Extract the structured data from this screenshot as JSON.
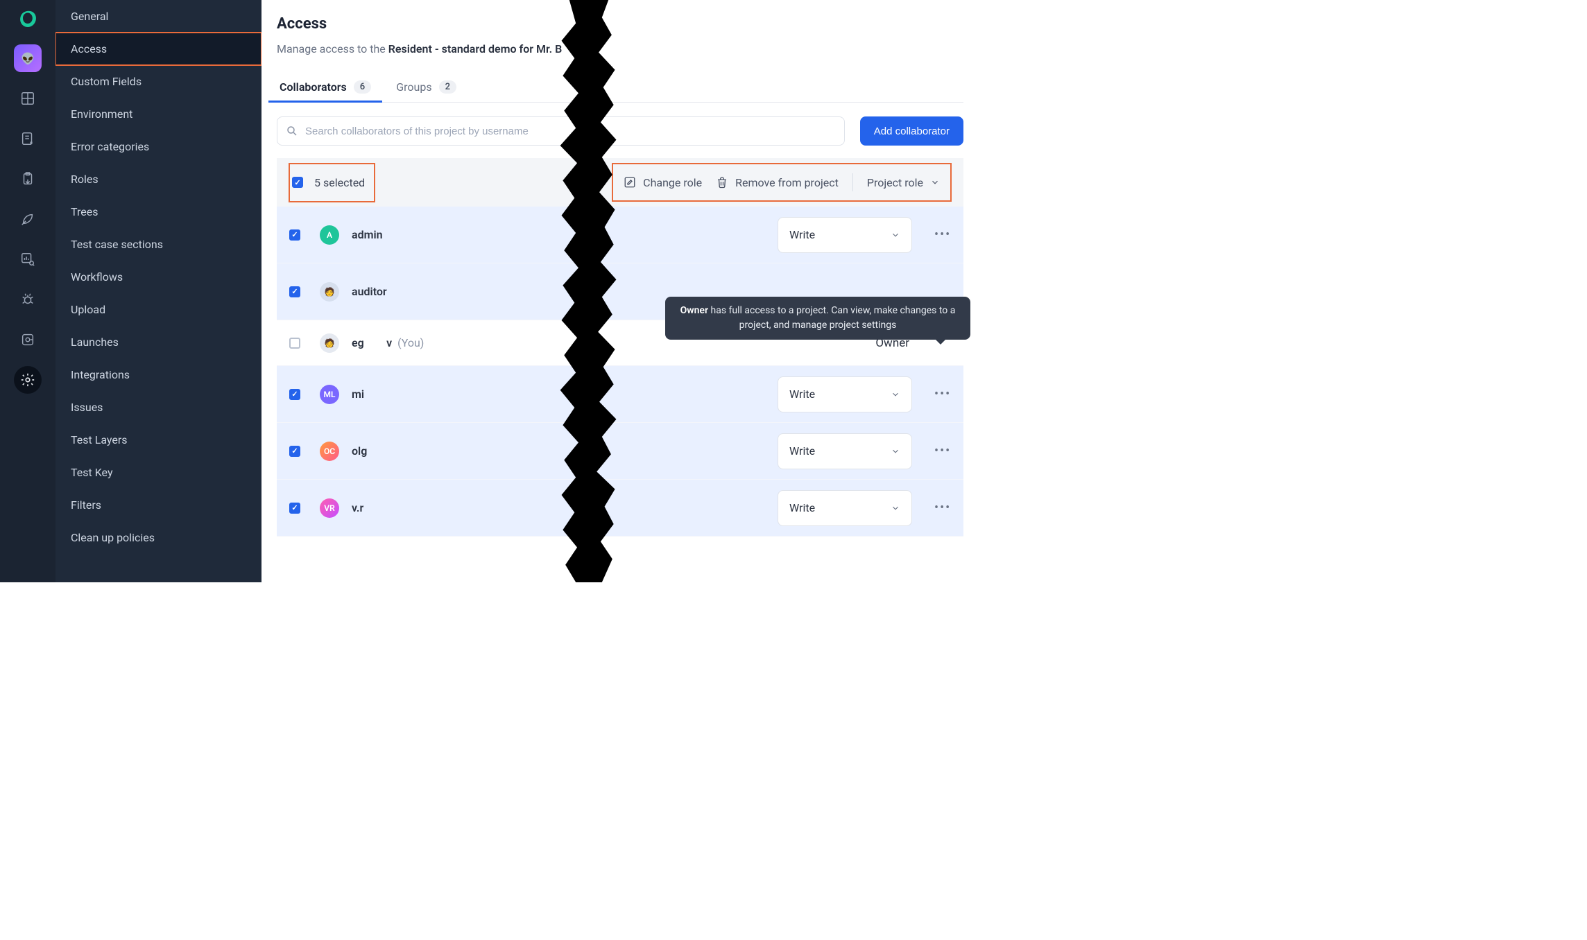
{
  "rail": {},
  "sidebar": {
    "items": [
      {
        "label": "General"
      },
      {
        "label": "Access"
      },
      {
        "label": "Custom Fields"
      },
      {
        "label": "Environment"
      },
      {
        "label": "Error categories"
      },
      {
        "label": "Roles"
      },
      {
        "label": "Trees"
      },
      {
        "label": "Test case sections"
      },
      {
        "label": "Workflows"
      },
      {
        "label": "Upload"
      },
      {
        "label": "Launches"
      },
      {
        "label": "Integrations"
      },
      {
        "label": "Issues"
      },
      {
        "label": "Test Layers"
      },
      {
        "label": "Test Key"
      },
      {
        "label": "Filters"
      },
      {
        "label": "Clean up policies"
      }
    ],
    "active_index": 1
  },
  "page": {
    "title": "Access",
    "subtitle_prefix": "Manage access to the ",
    "subtitle_bold": "Resident - standard demo for Mr. B"
  },
  "tabs": {
    "collaborators_label": "Collaborators",
    "collaborators_count": "6",
    "groups_label": "Groups",
    "groups_count": "2"
  },
  "toolbar": {
    "search_placeholder": "Search collaborators of this project by username",
    "add_button": "Add collaborator"
  },
  "selection": {
    "count_text": "5 selected",
    "change_role": "Change role",
    "remove": "Remove from project",
    "project_role": "Project role"
  },
  "tooltip": {
    "strong": "Owner",
    "rest": " has full access to a project. Can view, make changes to a project, and manage project settings"
  },
  "collaborators": [
    {
      "checked": true,
      "avatar_text": "A",
      "avatar_bg": "#1fc59a",
      "name": "admin",
      "role": "Write",
      "you": false
    },
    {
      "checked": true,
      "avatar_text": "👤",
      "avatar_bg": "#d6dfee",
      "name": "auditor",
      "role": "",
      "you": false
    },
    {
      "checked": false,
      "avatar_text": "👤",
      "avatar_bg": "#e5e9f0",
      "name": "eg",
      "name_suffix": "v",
      "role": "Owner",
      "you": true
    },
    {
      "checked": true,
      "avatar_text": "ML",
      "avatar_bg": "#7a67ff",
      "name": "mi",
      "role": "Write",
      "you": false
    },
    {
      "checked": true,
      "avatar_text": "OC",
      "avatar_bg": "#ff7a3d",
      "name": "olg",
      "role": "Write",
      "you": false
    },
    {
      "checked": true,
      "avatar_text": "VR",
      "avatar_bg": "#ff4fa3",
      "name": "v.r",
      "role": "Write",
      "you": false
    }
  ],
  "you_label": "(You)"
}
